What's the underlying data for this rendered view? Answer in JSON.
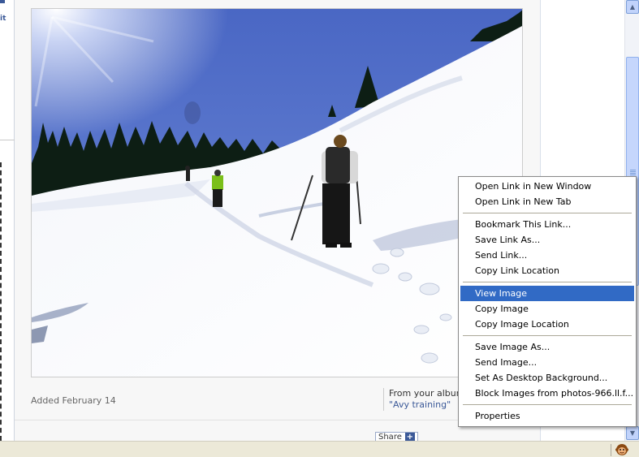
{
  "sidebar": {
    "fragment_text": "it"
  },
  "photo": {
    "added_label": "Added February 14",
    "album_label": "From your album:",
    "album_name": "\"Avy training\""
  },
  "share": {
    "label": "Share",
    "plus": "+"
  },
  "scrollbar": {
    "up_arrow": "▲",
    "down_arrow": "▼"
  },
  "context_menu": {
    "groups": [
      [
        "Open Link in New Window",
        "Open Link in New Tab"
      ],
      [
        "Bookmark This Link...",
        "Save Link As...",
        "Send Link...",
        "Copy Link Location"
      ],
      [
        "View Image",
        "Copy Image",
        "Copy Image Location"
      ],
      [
        "Save Image As...",
        "Send Image...",
        "Set As Desktop Background...",
        "Block Images from photos-966.ll.f..."
      ],
      [
        "Properties"
      ]
    ],
    "highlighted": "View Image",
    "highlight_color": "#316ac5"
  },
  "colors": {
    "link_blue": "#3b5998",
    "status_bg": "#ece9d8"
  }
}
